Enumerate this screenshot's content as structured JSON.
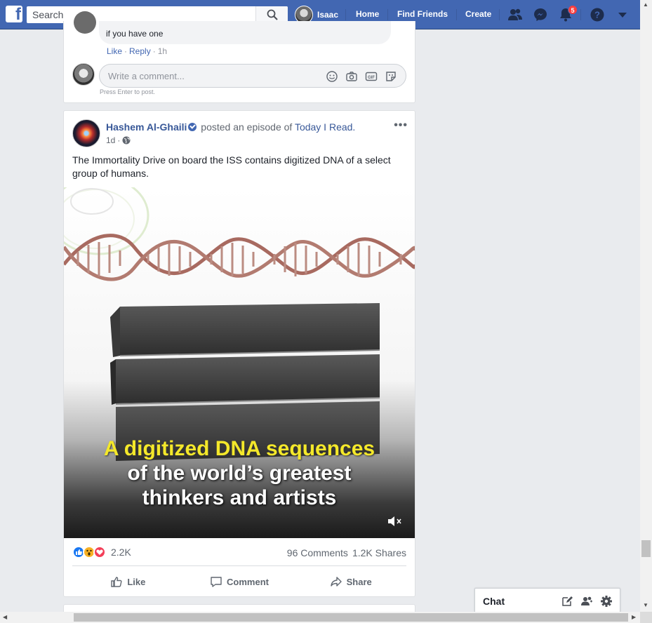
{
  "topbar": {
    "search_placeholder": "Search",
    "user_name": "Isaac",
    "nav": [
      "Home",
      "Find Friends",
      "Create"
    ],
    "notification_count": "5",
    "icons": [
      "facebook-logo-icon",
      "search-icon",
      "friend-requests-icon",
      "messenger-icon",
      "notifications-icon",
      "help-icon",
      "account-menu-icon"
    ]
  },
  "prev_comment": {
    "text": "if you have one",
    "actions": [
      "Like",
      "Reply"
    ],
    "time": "1h",
    "input_placeholder": "Write a comment...",
    "hint": "Press Enter to post.",
    "input_icons": [
      "emoji-icon",
      "camera-icon",
      "gif-icon",
      "sticker-icon"
    ]
  },
  "post": {
    "author": "Hashem Al-Ghaili",
    "verb": "posted an episode of",
    "page": "Today I Read.",
    "time": "1d",
    "more": "•••",
    "text": "The Immortality Drive on board the ISS contains digitized DNA of a select group of humans.",
    "video": {
      "caption_lines": [
        "A digitized DNA sequences",
        "of the world’s greatest",
        "thinkers and artists"
      ]
    },
    "reactions": {
      "types": [
        "like",
        "wow",
        "love"
      ],
      "count": "2.2K"
    },
    "comments_count": "96 Comments",
    "shares_count": "1.2K Shares",
    "actions": [
      "Like",
      "Comment",
      "Share"
    ]
  },
  "chat": {
    "label": "Chat"
  },
  "colors": {
    "brand": "#4267b2",
    "link": "#385898",
    "caption_yellow": "#f4e82a"
  }
}
